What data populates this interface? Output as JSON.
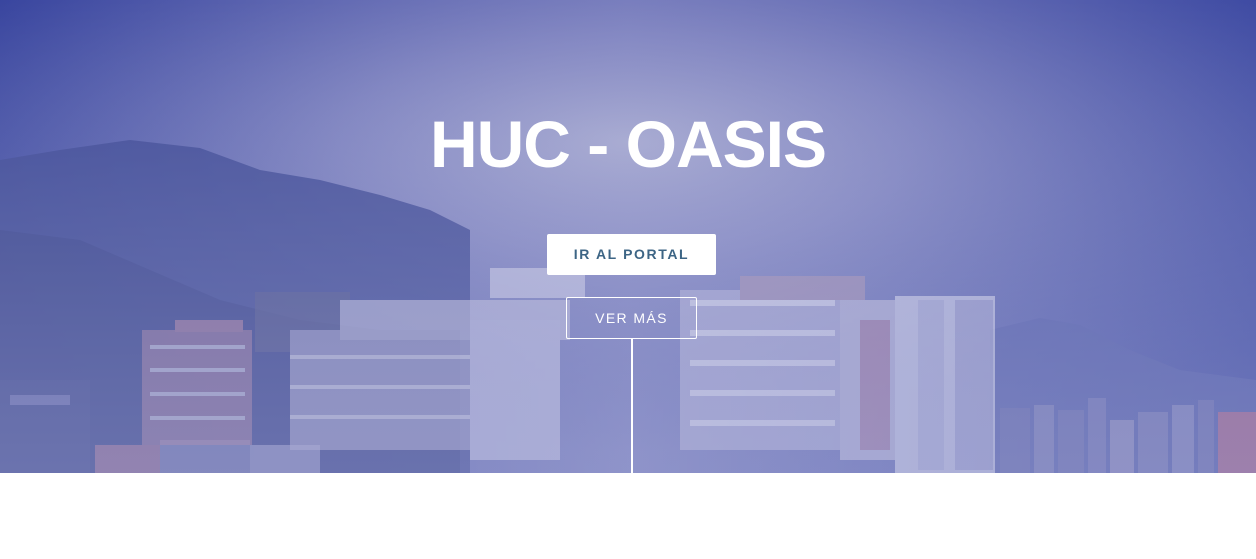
{
  "hero": {
    "title": "HUC - OASIS",
    "primary_button_label": "IR AL PORTAL",
    "secondary_button_label": "VER MÁS",
    "overlay_color": "#3b48a0",
    "background_image": "hospital-building-with-mountains"
  },
  "colors": {
    "primary_button_text": "#3d6585",
    "white": "#ffffff"
  }
}
